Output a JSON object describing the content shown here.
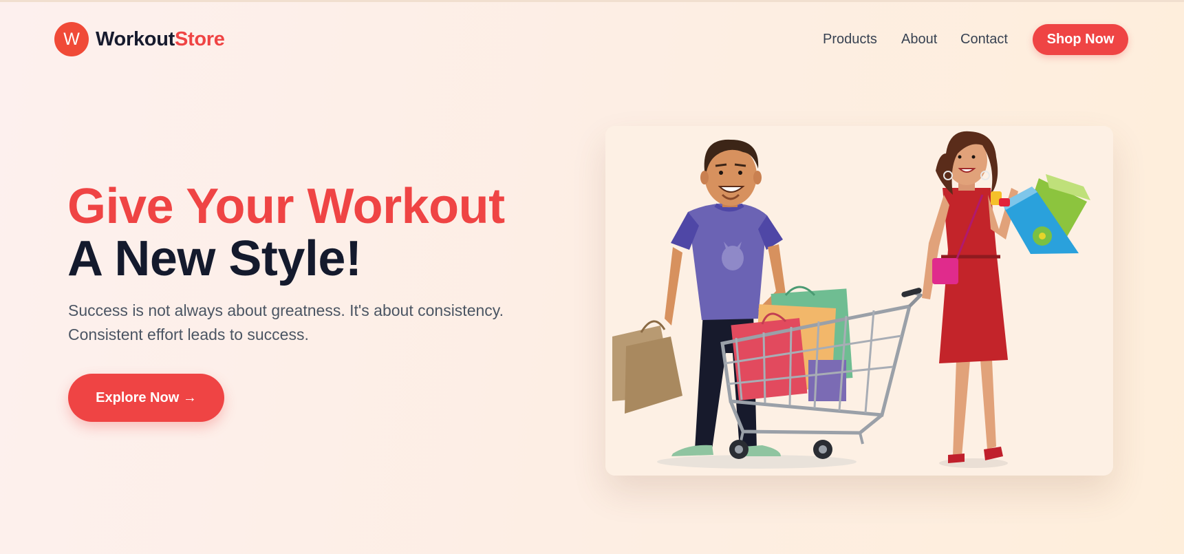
{
  "brand": {
    "logo_letter": "W",
    "name_part1": "Workout",
    "name_part2": "Store"
  },
  "nav": {
    "links": [
      {
        "label": "Products"
      },
      {
        "label": "About"
      },
      {
        "label": "Contact"
      }
    ],
    "cta_label": "Shop Now"
  },
  "hero": {
    "title_line1": "Give Your Workout",
    "title_line2": "A New Style!",
    "subtitle_line1": "Success is not always about greatness. It's about consistency.",
    "subtitle_line2": "Consistent effort leads to success.",
    "button_label": "Explore Now →"
  },
  "illustration": {
    "alt": "Shopping couple illustration",
    "icon": "shopping-illustration"
  },
  "colors": {
    "accent": "#ef4444",
    "logo_circle": "#f04a37",
    "heading_dark": "#141a2d",
    "body_text": "#4b5563",
    "nav_text": "#374151"
  }
}
